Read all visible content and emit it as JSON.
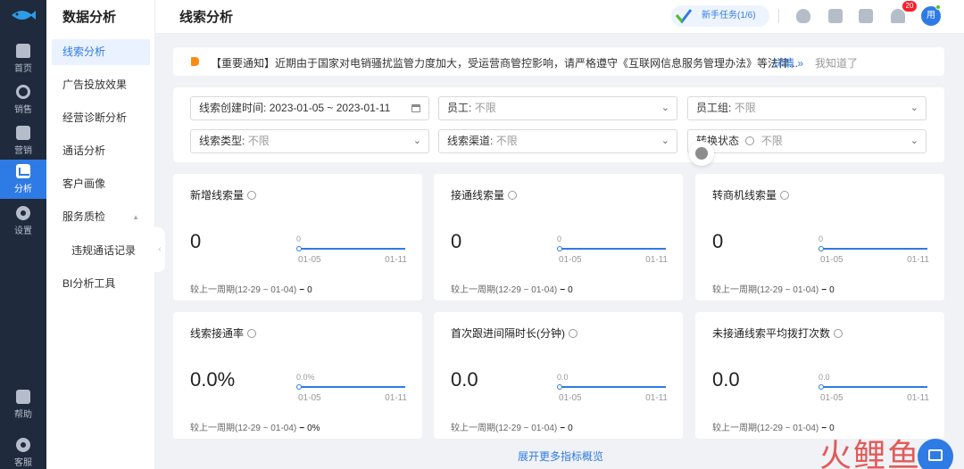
{
  "rail": {
    "items": [
      {
        "label": "首页",
        "icon": "home-icon"
      },
      {
        "label": "销售",
        "icon": "phone-icon"
      },
      {
        "label": "营销",
        "icon": "edit-icon"
      },
      {
        "label": "分析",
        "icon": "chart-icon",
        "active": true
      },
      {
        "label": "设置",
        "icon": "gear-icon"
      },
      {
        "label": "帮助",
        "icon": "book-icon"
      },
      {
        "label": "客服",
        "icon": "headset-icon"
      }
    ]
  },
  "sidebar": {
    "title": "数据分析",
    "items": [
      {
        "label": "线索分析",
        "active": true
      },
      {
        "label": "广告投放效果"
      },
      {
        "label": "经营诊断分析"
      },
      {
        "label": "通话分析"
      },
      {
        "label": "客户画像"
      },
      {
        "label": "服务质检"
      },
      {
        "label": "违规通话记录"
      },
      {
        "label": "BI分析工具"
      }
    ]
  },
  "header": {
    "title": "线索分析",
    "task_label": "新手任务(1/6)",
    "bell_badge": "20",
    "avatar_text": "用"
  },
  "notice": {
    "text": "【重要通知】近期由于国家对电销骚扰监管力度加大，受运营商管控影响，请严格遵守《互联网信息服务管理办法》等法律...",
    "detail_label": "详情 »",
    "dismiss_label": "我知道了"
  },
  "filters": {
    "date": {
      "label": "线索创建时间:",
      "value": "2023-01-05 ~ 2023-01-11"
    },
    "employee": {
      "label": "员工:",
      "value": "不限"
    },
    "group": {
      "label": "员工组:",
      "value": "不限"
    },
    "type": {
      "label": "线索类型:",
      "value": "不限"
    },
    "channel": {
      "label": "线索渠道:",
      "value": "不限"
    },
    "status": {
      "label": "转换状态",
      "value": "不限"
    }
  },
  "metrics": [
    {
      "title": "新增线索量",
      "value": "0",
      "peak": "0",
      "x_start": "01-05",
      "x_end": "01-11",
      "compare_label": "较上一周期(12-29 ~ 01-04)",
      "compare_value": "0"
    },
    {
      "title": "接通线索量",
      "value": "0",
      "peak": "0",
      "x_start": "01-05",
      "x_end": "01-11",
      "compare_label": "较上一周期(12-29 ~ 01-04)",
      "compare_value": "0"
    },
    {
      "title": "转商机线索量",
      "value": "0",
      "peak": "0",
      "x_start": "01-05",
      "x_end": "01-11",
      "compare_label": "较上一周期(12-29 ~ 01-04)",
      "compare_value": "0"
    },
    {
      "title": "线索接通率",
      "value": "0.0%",
      "peak": "0.0%",
      "x_start": "01-05",
      "x_end": "01-11",
      "compare_label": "较上一周期(12-29 ~ 01-04)",
      "compare_value": "0%"
    },
    {
      "title": "首次跟进间隔时长(分钟)",
      "value": "0.0",
      "peak": "0.0",
      "x_start": "01-05",
      "x_end": "01-11",
      "compare_label": "较上一周期(12-29 ~ 01-04)",
      "compare_value": "0"
    },
    {
      "title": "未接通线索平均拨打次数",
      "value": "0.0",
      "peak": "0.0",
      "x_start": "01-05",
      "x_end": "01-11",
      "compare_label": "较上一周期(12-29 ~ 01-04)",
      "compare_value": "0"
    }
  ],
  "more_label": "展开更多指标概览",
  "watermark": "火鲤鱼",
  "colors": {
    "accent": "#2f7be5",
    "rail_bg": "#1f2a3c",
    "badge": "#f5222d"
  }
}
